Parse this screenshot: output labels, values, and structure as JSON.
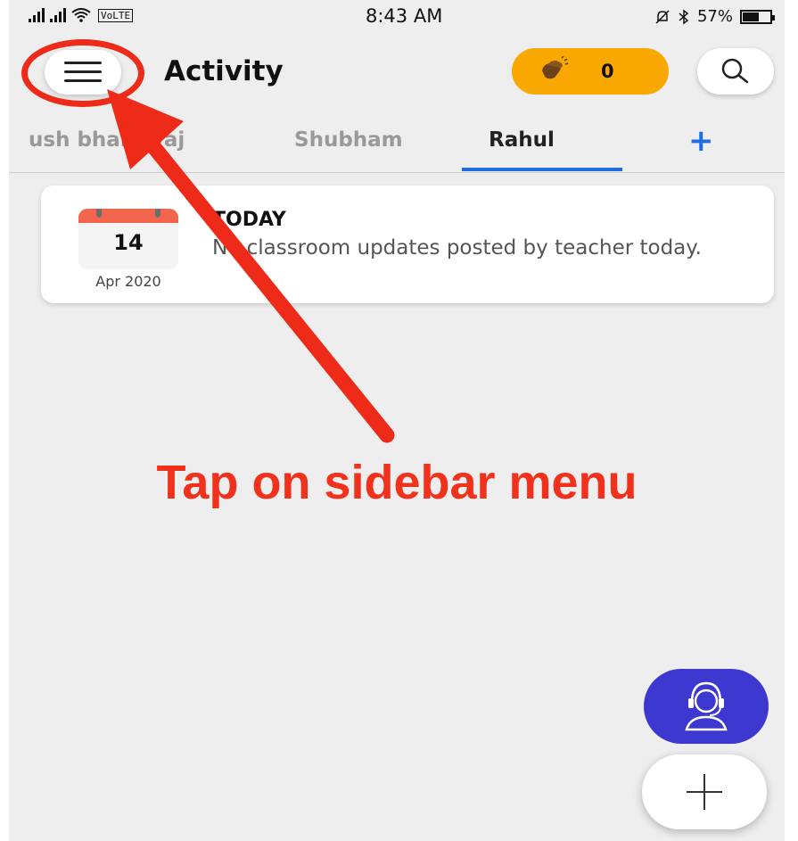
{
  "status_bar": {
    "network_badge": "VoLTE",
    "time": "8:43 AM",
    "battery": "57%",
    "battery_level": 0.57
  },
  "header": {
    "title": "Activity",
    "claps_count": "0"
  },
  "tabs": [
    {
      "label": "ush bhardwaj",
      "active": false
    },
    {
      "label": "Shubham",
      "active": false
    },
    {
      "label": "Rahul",
      "active": true
    }
  ],
  "card": {
    "day": "14",
    "month_year": "Apr 2020",
    "title": "TODAY",
    "message": "No classroom updates posted by teacher today."
  },
  "annotation": {
    "instruction": "Tap on sidebar menu",
    "color": "#f0311b"
  },
  "colors": {
    "accent_blue": "#1f6de0",
    "claps_orange": "#f9a802",
    "support_fab": "#3d39d0"
  },
  "icons": [
    "hamburger-menu-icon",
    "clap-icon",
    "search-icon",
    "plus-icon",
    "calendar-icon",
    "headset-agent-icon"
  ]
}
